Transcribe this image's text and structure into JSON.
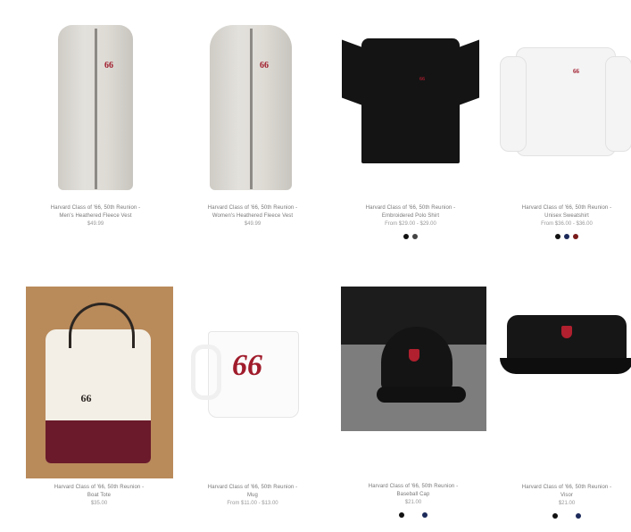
{
  "products": [
    {
      "title": "Harvard Class of '66, 50th Reunion -\nMen's Heathered Fleece Vest",
      "price": "$49.99",
      "image": "men-fleece-vest",
      "swatches": []
    },
    {
      "title": "Harvard Class of '66, 50th Reunion -\nWomen's Heathered Fleece Vest",
      "price": "$49.99",
      "image": "women-fleece-vest",
      "swatches": []
    },
    {
      "title": "Harvard Class of '66, 50th Reunion -\nEmbroidered Polo Shirt",
      "price": "From $29.00 - $29.00",
      "image": "polo-shirt",
      "swatches": [
        "#111111",
        "#444444"
      ]
    },
    {
      "title": "Harvard Class of '66, 50th Reunion -\nUnisex Sweatshirt",
      "price": "From $36.00 - $36.00",
      "image": "sweatshirt",
      "swatches": [
        "#111111",
        "#1c2a5a",
        "#7a1a1a"
      ]
    },
    {
      "title": "Harvard Class of '66, 50th Reunion -\nBoat Tote",
      "price": "$35.00",
      "image": "boat-tote",
      "swatches": []
    },
    {
      "title": "Harvard Class of '66, 50th Reunion -\nMug",
      "price": "From $11.00 - $13.00",
      "image": "mug",
      "swatches": []
    },
    {
      "title": "Harvard Class of '66, 50th Reunion -\nBaseball Cap",
      "price": "$21.00",
      "image": "baseball-cap",
      "swatches": [
        "#111111",
        "#1c2a5a"
      ]
    },
    {
      "title": "Harvard Class of '66, 50th Reunion -\nVisor",
      "price": "$21.00",
      "image": "visor",
      "swatches": [
        "#111111",
        "#1c2a5a"
      ]
    }
  ],
  "logo_text": "66",
  "brand_color": "#a01c2c"
}
